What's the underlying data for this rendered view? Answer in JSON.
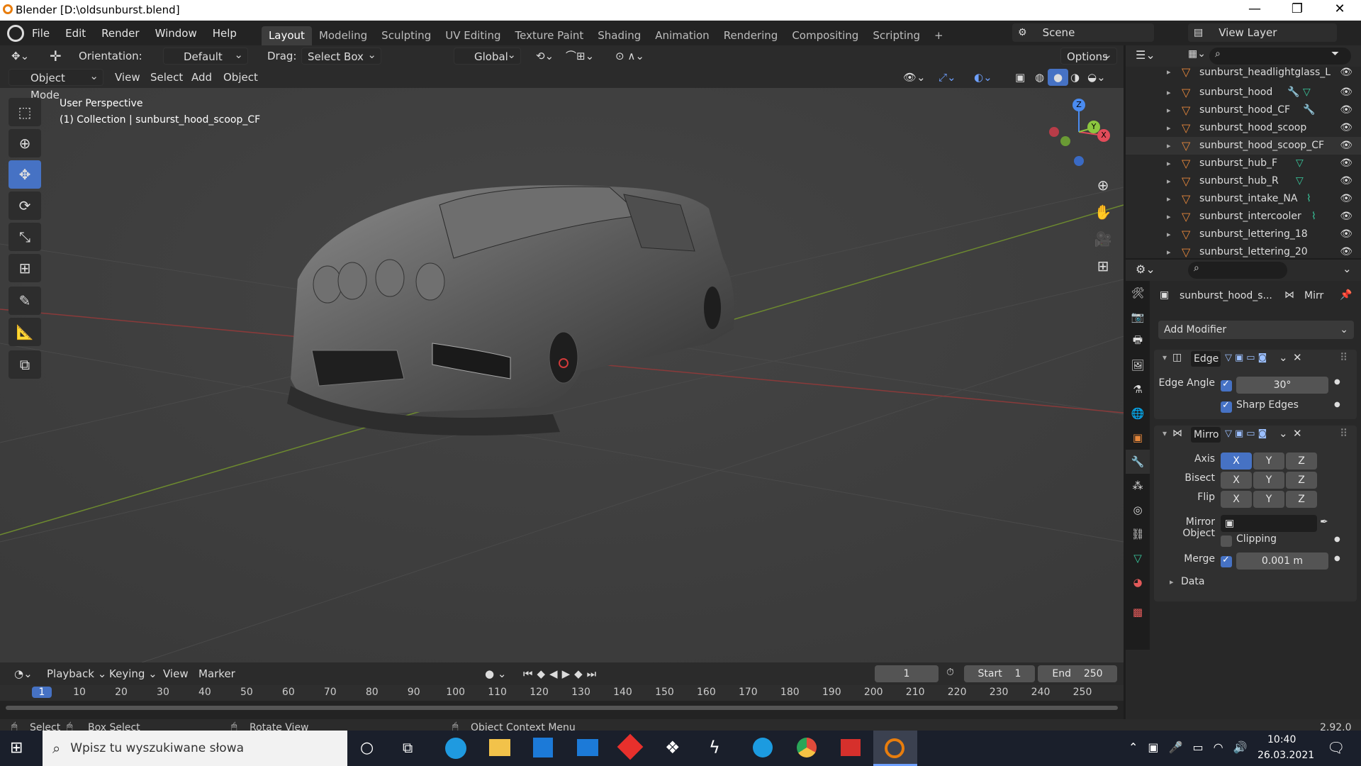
{
  "window": {
    "title": "Blender [D:\\oldsunburst.blend]",
    "controls": [
      "—",
      "❐",
      "✕"
    ]
  },
  "menu": [
    "File",
    "Edit",
    "Render",
    "Window",
    "Help"
  ],
  "workspaces": [
    "Layout",
    "Modeling",
    "Sculpting",
    "UV Editing",
    "Texture Paint",
    "Shading",
    "Animation",
    "Rendering",
    "Compositing",
    "Scripting",
    "+"
  ],
  "active_workspace": "Layout",
  "scene": {
    "name": "Scene",
    "view_layer": "View Layer"
  },
  "viewport_header": {
    "orientation_label": "Orientation:",
    "orientation_value": "Default",
    "drag_label": "Drag:",
    "drag_value": "Select Box",
    "transform_space": "Global",
    "options": "Options",
    "mode": "Object Mode",
    "menus": [
      "View",
      "Select",
      "Add",
      "Object"
    ]
  },
  "viewport_info": {
    "line1": "User Perspective",
    "line2": "(1) Collection | sunburst_hood_scoop_CF"
  },
  "gizmo_axes": {
    "x": "X",
    "y": "Y",
    "z": "Z"
  },
  "outliner": {
    "rows": [
      {
        "name": "sunburst_headlightglass_L"
      },
      {
        "name": "sunburst_hood"
      },
      {
        "name": "sunburst_hood_CF"
      },
      {
        "name": "sunburst_hood_scoop"
      },
      {
        "name": "sunburst_hood_scoop_CF"
      },
      {
        "name": "sunburst_hub_F"
      },
      {
        "name": "sunburst_hub_R"
      },
      {
        "name": "sunburst_intake_NA"
      },
      {
        "name": "sunburst_intercooler"
      },
      {
        "name": "sunburst_lettering_18"
      },
      {
        "name": "sunburst_lettering_20"
      }
    ]
  },
  "properties": {
    "object_name": "sunburst_hood_s...",
    "modifier_tab": "Mirr",
    "add_modifier": "Add Modifier",
    "edge_split": {
      "name": "Edge",
      "edge_angle_label": "Edge Angle",
      "edge_angle_value": "30°",
      "sharp_edges_label": "Sharp Edges"
    },
    "mirror": {
      "name": "Mirro",
      "axis_label": "Axis",
      "bisect_label": "Bisect",
      "flip_label": "Flip",
      "axes": [
        "X",
        "Y",
        "Z"
      ],
      "mirror_object_label": "Mirror Object",
      "clipping_label": "Clipping",
      "merge_label": "Merge",
      "merge_value": "0.001 m",
      "data_label": "Data"
    }
  },
  "timeline": {
    "menus": [
      "Playback",
      "Keying",
      "View",
      "Marker"
    ],
    "current_frame": "1",
    "start_label": "Start",
    "start_value": "1",
    "end_label": "End",
    "end_value": "250",
    "ruler": [
      "1",
      "10",
      "20",
      "30",
      "40",
      "50",
      "60",
      "70",
      "80",
      "90",
      "100",
      "110",
      "120",
      "130",
      "140",
      "150",
      "160",
      "170",
      "180",
      "190",
      "200",
      "210",
      "220",
      "230",
      "240",
      "250"
    ]
  },
  "statusbar": {
    "select": "Select",
    "box_select": "Box Select",
    "rotate": "Rotate View",
    "context": "Object Context Menu",
    "version": "2.92.0"
  },
  "taskbar": {
    "search_placeholder": "Wpisz tu wyszukiwane słowa",
    "time": "10:40",
    "date": "26.03.2021"
  }
}
